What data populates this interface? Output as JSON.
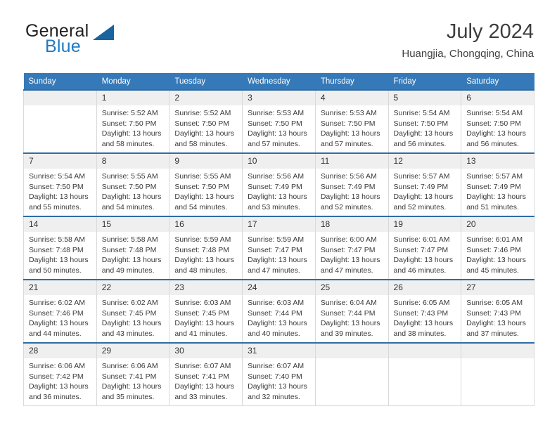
{
  "brand": {
    "name_part1": "General",
    "name_part2": "Blue",
    "logo_icon": "triangle-logo-icon"
  },
  "header": {
    "title": "July 2024",
    "subtitle": "Huangjia, Chongqing, China"
  },
  "colors": {
    "header_blue": "#3679b8",
    "row_top_border": "#2e6da4",
    "daynum_bg": "#efefef",
    "brand_blue": "#1f7ac4",
    "cell_border": "#d9d9d9"
  },
  "weekdays": [
    "Sunday",
    "Monday",
    "Tuesday",
    "Wednesday",
    "Thursday",
    "Friday",
    "Saturday"
  ],
  "weeks": [
    [
      {
        "day": "",
        "sunrise": "",
        "sunset": "",
        "daylight_line1": "",
        "daylight_line2": "",
        "blank": true
      },
      {
        "day": "1",
        "sunrise": "Sunrise: 5:52 AM",
        "sunset": "Sunset: 7:50 PM",
        "daylight_line1": "Daylight: 13 hours",
        "daylight_line2": "and 58 minutes."
      },
      {
        "day": "2",
        "sunrise": "Sunrise: 5:52 AM",
        "sunset": "Sunset: 7:50 PM",
        "daylight_line1": "Daylight: 13 hours",
        "daylight_line2": "and 58 minutes."
      },
      {
        "day": "3",
        "sunrise": "Sunrise: 5:53 AM",
        "sunset": "Sunset: 7:50 PM",
        "daylight_line1": "Daylight: 13 hours",
        "daylight_line2": "and 57 minutes."
      },
      {
        "day": "4",
        "sunrise": "Sunrise: 5:53 AM",
        "sunset": "Sunset: 7:50 PM",
        "daylight_line1": "Daylight: 13 hours",
        "daylight_line2": "and 57 minutes."
      },
      {
        "day": "5",
        "sunrise": "Sunrise: 5:54 AM",
        "sunset": "Sunset: 7:50 PM",
        "daylight_line1": "Daylight: 13 hours",
        "daylight_line2": "and 56 minutes."
      },
      {
        "day": "6",
        "sunrise": "Sunrise: 5:54 AM",
        "sunset": "Sunset: 7:50 PM",
        "daylight_line1": "Daylight: 13 hours",
        "daylight_line2": "and 56 minutes."
      }
    ],
    [
      {
        "day": "7",
        "sunrise": "Sunrise: 5:54 AM",
        "sunset": "Sunset: 7:50 PM",
        "daylight_line1": "Daylight: 13 hours",
        "daylight_line2": "and 55 minutes."
      },
      {
        "day": "8",
        "sunrise": "Sunrise: 5:55 AM",
        "sunset": "Sunset: 7:50 PM",
        "daylight_line1": "Daylight: 13 hours",
        "daylight_line2": "and 54 minutes."
      },
      {
        "day": "9",
        "sunrise": "Sunrise: 5:55 AM",
        "sunset": "Sunset: 7:50 PM",
        "daylight_line1": "Daylight: 13 hours",
        "daylight_line2": "and 54 minutes."
      },
      {
        "day": "10",
        "sunrise": "Sunrise: 5:56 AM",
        "sunset": "Sunset: 7:49 PM",
        "daylight_line1": "Daylight: 13 hours",
        "daylight_line2": "and 53 minutes."
      },
      {
        "day": "11",
        "sunrise": "Sunrise: 5:56 AM",
        "sunset": "Sunset: 7:49 PM",
        "daylight_line1": "Daylight: 13 hours",
        "daylight_line2": "and 52 minutes."
      },
      {
        "day": "12",
        "sunrise": "Sunrise: 5:57 AM",
        "sunset": "Sunset: 7:49 PM",
        "daylight_line1": "Daylight: 13 hours",
        "daylight_line2": "and 52 minutes."
      },
      {
        "day": "13",
        "sunrise": "Sunrise: 5:57 AM",
        "sunset": "Sunset: 7:49 PM",
        "daylight_line1": "Daylight: 13 hours",
        "daylight_line2": "and 51 minutes."
      }
    ],
    [
      {
        "day": "14",
        "sunrise": "Sunrise: 5:58 AM",
        "sunset": "Sunset: 7:48 PM",
        "daylight_line1": "Daylight: 13 hours",
        "daylight_line2": "and 50 minutes."
      },
      {
        "day": "15",
        "sunrise": "Sunrise: 5:58 AM",
        "sunset": "Sunset: 7:48 PM",
        "daylight_line1": "Daylight: 13 hours",
        "daylight_line2": "and 49 minutes."
      },
      {
        "day": "16",
        "sunrise": "Sunrise: 5:59 AM",
        "sunset": "Sunset: 7:48 PM",
        "daylight_line1": "Daylight: 13 hours",
        "daylight_line2": "and 48 minutes."
      },
      {
        "day": "17",
        "sunrise": "Sunrise: 5:59 AM",
        "sunset": "Sunset: 7:47 PM",
        "daylight_line1": "Daylight: 13 hours",
        "daylight_line2": "and 47 minutes."
      },
      {
        "day": "18",
        "sunrise": "Sunrise: 6:00 AM",
        "sunset": "Sunset: 7:47 PM",
        "daylight_line1": "Daylight: 13 hours",
        "daylight_line2": "and 47 minutes."
      },
      {
        "day": "19",
        "sunrise": "Sunrise: 6:01 AM",
        "sunset": "Sunset: 7:47 PM",
        "daylight_line1": "Daylight: 13 hours",
        "daylight_line2": "and 46 minutes."
      },
      {
        "day": "20",
        "sunrise": "Sunrise: 6:01 AM",
        "sunset": "Sunset: 7:46 PM",
        "daylight_line1": "Daylight: 13 hours",
        "daylight_line2": "and 45 minutes."
      }
    ],
    [
      {
        "day": "21",
        "sunrise": "Sunrise: 6:02 AM",
        "sunset": "Sunset: 7:46 PM",
        "daylight_line1": "Daylight: 13 hours",
        "daylight_line2": "and 44 minutes."
      },
      {
        "day": "22",
        "sunrise": "Sunrise: 6:02 AM",
        "sunset": "Sunset: 7:45 PM",
        "daylight_line1": "Daylight: 13 hours",
        "daylight_line2": "and 43 minutes."
      },
      {
        "day": "23",
        "sunrise": "Sunrise: 6:03 AM",
        "sunset": "Sunset: 7:45 PM",
        "daylight_line1": "Daylight: 13 hours",
        "daylight_line2": "and 41 minutes."
      },
      {
        "day": "24",
        "sunrise": "Sunrise: 6:03 AM",
        "sunset": "Sunset: 7:44 PM",
        "daylight_line1": "Daylight: 13 hours",
        "daylight_line2": "and 40 minutes."
      },
      {
        "day": "25",
        "sunrise": "Sunrise: 6:04 AM",
        "sunset": "Sunset: 7:44 PM",
        "daylight_line1": "Daylight: 13 hours",
        "daylight_line2": "and 39 minutes."
      },
      {
        "day": "26",
        "sunrise": "Sunrise: 6:05 AM",
        "sunset": "Sunset: 7:43 PM",
        "daylight_line1": "Daylight: 13 hours",
        "daylight_line2": "and 38 minutes."
      },
      {
        "day": "27",
        "sunrise": "Sunrise: 6:05 AM",
        "sunset": "Sunset: 7:43 PM",
        "daylight_line1": "Daylight: 13 hours",
        "daylight_line2": "and 37 minutes."
      }
    ],
    [
      {
        "day": "28",
        "sunrise": "Sunrise: 6:06 AM",
        "sunset": "Sunset: 7:42 PM",
        "daylight_line1": "Daylight: 13 hours",
        "daylight_line2": "and 36 minutes."
      },
      {
        "day": "29",
        "sunrise": "Sunrise: 6:06 AM",
        "sunset": "Sunset: 7:41 PM",
        "daylight_line1": "Daylight: 13 hours",
        "daylight_line2": "and 35 minutes."
      },
      {
        "day": "30",
        "sunrise": "Sunrise: 6:07 AM",
        "sunset": "Sunset: 7:41 PM",
        "daylight_line1": "Daylight: 13 hours",
        "daylight_line2": "and 33 minutes."
      },
      {
        "day": "31",
        "sunrise": "Sunrise: 6:07 AM",
        "sunset": "Sunset: 7:40 PM",
        "daylight_line1": "Daylight: 13 hours",
        "daylight_line2": "and 32 minutes."
      },
      {
        "day": "",
        "sunrise": "",
        "sunset": "",
        "daylight_line1": "",
        "daylight_line2": "",
        "blank": true
      },
      {
        "day": "",
        "sunrise": "",
        "sunset": "",
        "daylight_line1": "",
        "daylight_line2": "",
        "blank": true
      },
      {
        "day": "",
        "sunrise": "",
        "sunset": "",
        "daylight_line1": "",
        "daylight_line2": "",
        "blank": true
      }
    ]
  ]
}
